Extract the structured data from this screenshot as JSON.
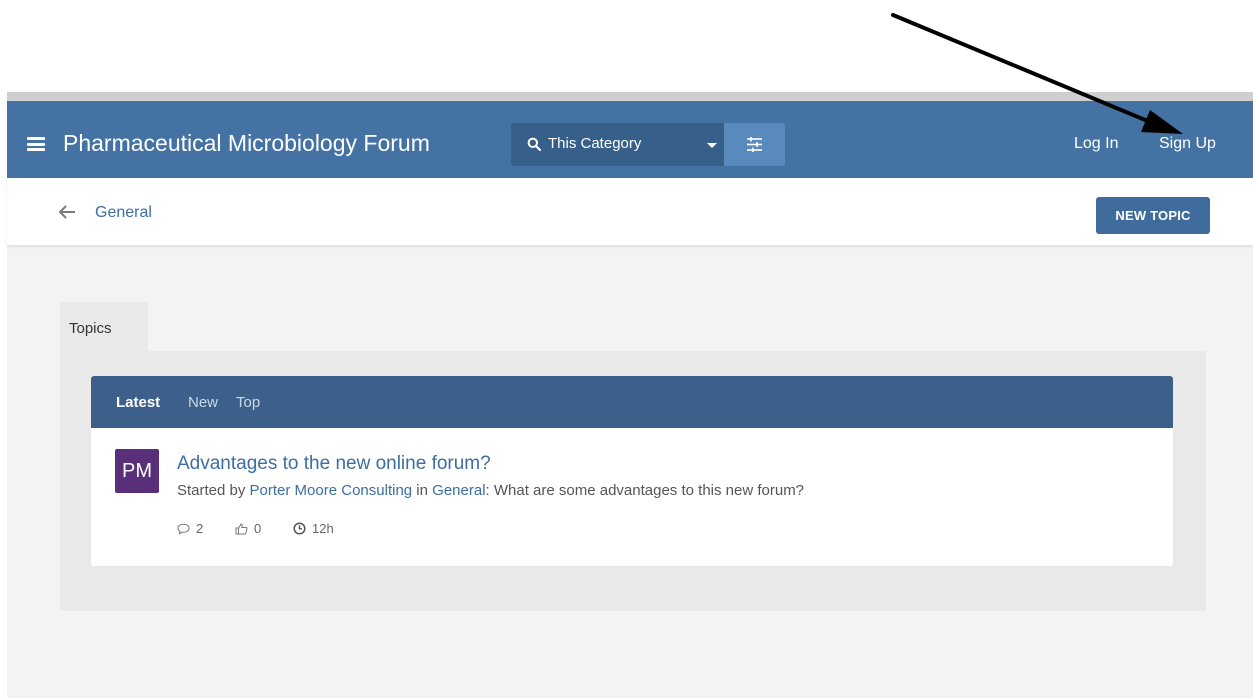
{
  "header": {
    "title": "Pharmaceutical Microbiology Forum",
    "search_scope": "This Category",
    "login_label": "Log In",
    "signup_label": "Sign Up"
  },
  "breadcrumb": {
    "label": "General",
    "new_topic_label": "NEW TOPIC"
  },
  "topics_tab": {
    "label": "Topics"
  },
  "list_tabs": [
    {
      "label": "Latest",
      "active": true
    },
    {
      "label": "New",
      "active": false
    },
    {
      "label": "Top",
      "active": false
    }
  ],
  "topics": [
    {
      "avatar_initials": "PM",
      "title": "Advantages to the new online forum?",
      "started_by_prefix": "Started by",
      "author": "Porter Moore Consulting",
      "in_word": "in",
      "category": "General",
      "excerpt": ": What are some advantages to this new forum?",
      "replies": "2",
      "likes": "0",
      "age": "12h"
    }
  ],
  "icons": {
    "menu": "hamburger-menu-icon",
    "search": "search-icon",
    "dropdown": "caret-down-icon",
    "filter": "filter-sliders-icon",
    "back": "back-arrow-icon",
    "replies": "speech-bubble-icon",
    "likes": "thumbs-up-icon",
    "age": "clock-icon",
    "annotation": "annotation-arrow"
  },
  "colors": {
    "header_bg": "#4472a3",
    "search_bg": "#365f8a",
    "filter_bg": "#5a89bd",
    "list_header_bg": "#3c6089",
    "link": "#3c6ea2",
    "avatar_bg": "#5a2f7a",
    "button_bg": "#3f6c9c"
  }
}
